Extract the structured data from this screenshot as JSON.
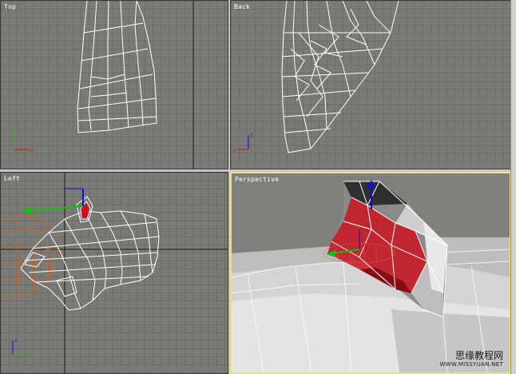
{
  "viewports": {
    "top": {
      "label": "Top"
    },
    "back": {
      "label": "Back"
    },
    "left": {
      "label": "Left"
    },
    "perspective": {
      "label": "Perspective",
      "active": true
    }
  },
  "axes": {
    "x": "x",
    "y": "y",
    "z": "z"
  },
  "watermark": {
    "text": "思缘教程网",
    "url": "WWW.MISSYUAN.NET"
  },
  "colors": {
    "viewport_bg": "#7a7b77",
    "grid": "#6d6e6b",
    "active_border": "#e8e486",
    "wire_white": "#ffffff",
    "wire_orange": "#c8642a",
    "selection_red": "#c8141e",
    "gizmo_x": "#d01010",
    "gizmo_y": "#10c010",
    "gizmo_z": "#1010d0"
  },
  "icons": [
    "axis-tripod-icon",
    "move-gizmo-icon"
  ]
}
